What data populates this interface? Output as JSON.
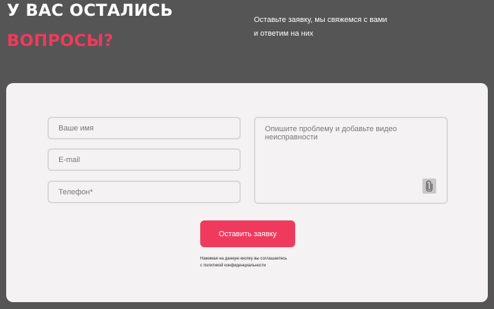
{
  "header": {
    "title_line1": "У ВАС ОСТАЛИСЬ",
    "title_line2": "ВОПРОСЫ?",
    "subtext_line1": "Оставьте заявку, мы свяжемся с вами",
    "subtext_line2": "и ответим на них"
  },
  "form": {
    "name_placeholder": "Ваше имя",
    "email_placeholder": "E-mail",
    "phone_placeholder": "Телефон*",
    "message_placeholder": "Опишите проблему и добавьте видео неисправности",
    "attach_icon": "paperclip-icon",
    "submit_label": "Оставить заявку",
    "legal_line1": "Нажимая на данную кнопку вы соглашаетесь",
    "legal_line2": "с политикой конфиденциальности"
  },
  "colors": {
    "background": "#555555",
    "card": "#f4f2f2",
    "accent": "#ef3a5d"
  }
}
